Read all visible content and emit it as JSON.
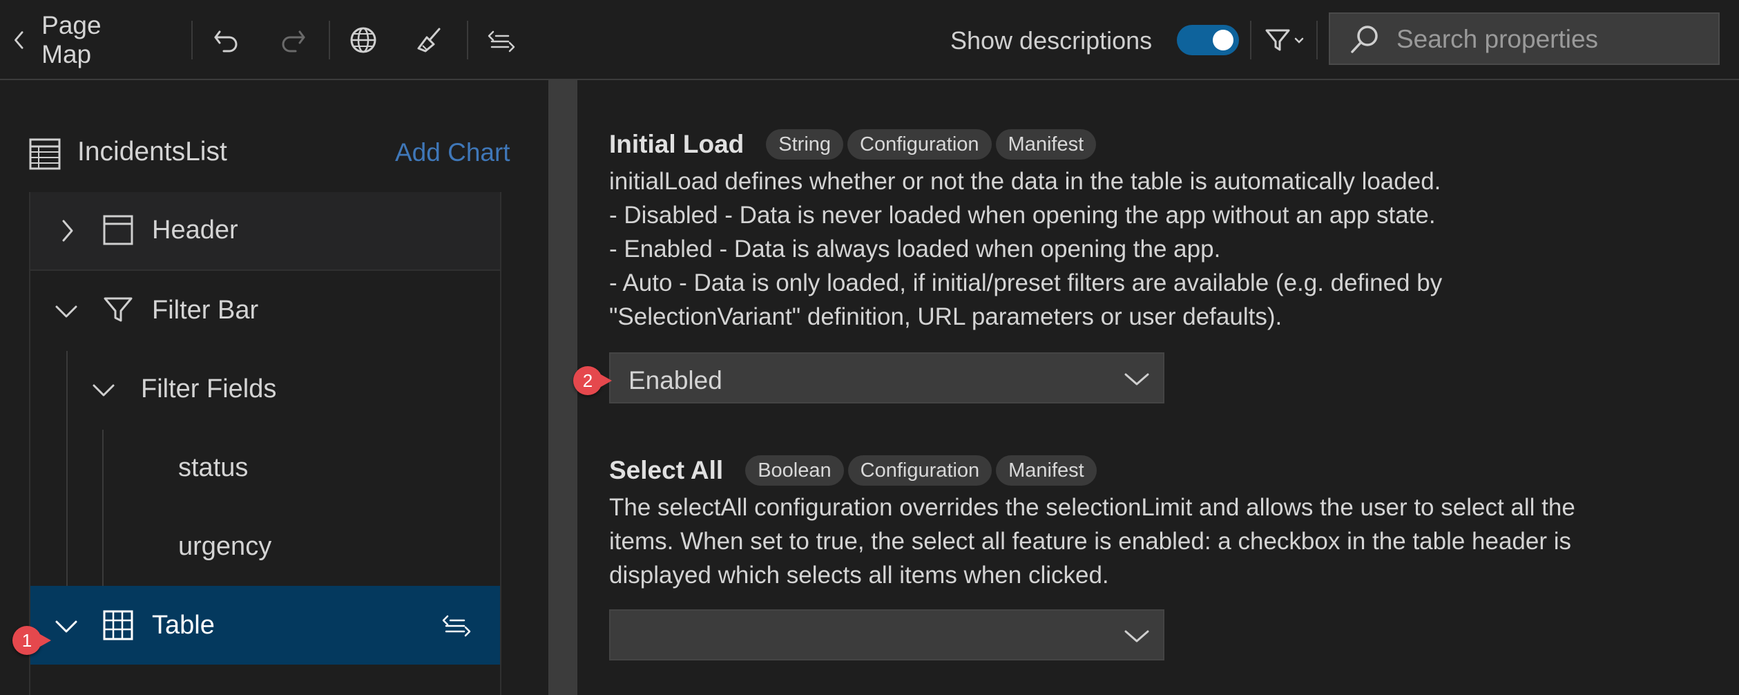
{
  "toolbar": {
    "title": "Page Map",
    "show_descriptions_label": "Show descriptions",
    "show_descriptions_on": true,
    "search_placeholder": "Search properties"
  },
  "outline": {
    "root_label": "IncidentsList",
    "add_chart_label": "Add Chart",
    "nodes": [
      {
        "label": "Header",
        "expanded": false,
        "icon": "header-layout-icon"
      },
      {
        "label": "Filter Bar",
        "expanded": true,
        "icon": "filter-icon"
      },
      {
        "label": "Filter Fields",
        "expanded": true
      },
      {
        "label": "status"
      },
      {
        "label": "urgency"
      },
      {
        "label": "Table",
        "expanded": true,
        "icon": "table-grid-icon",
        "selected": true
      }
    ]
  },
  "properties": {
    "initial_load": {
      "title": "Initial Load",
      "tags": [
        "String",
        "Configuration",
        "Manifest"
      ],
      "description_lines": [
        "initialLoad defines whether or not the data in the table is automatically loaded.",
        "- Disabled - Data is never loaded when opening the app without an app state.",
        "- Enabled - Data is always loaded when opening the app.",
        "- Auto - Data is only loaded, if initial/preset filters are available (e.g. defined by",
        "\"SelectionVariant\" definition, URL parameters or user defaults)."
      ],
      "value": "Enabled"
    },
    "select_all": {
      "title": "Select All",
      "tags": [
        "Boolean",
        "Configuration",
        "Manifest"
      ],
      "description_lines": [
        "The selectAll configuration overrides the selectionLimit and allows the user to select all the",
        "items. When set to true, the select all feature is enabled: a checkbox in the table header is",
        "displayed which selects all items when clicked."
      ],
      "value": ""
    }
  },
  "markers": [
    "1",
    "2"
  ],
  "colors": {
    "background": "#1e1e1e",
    "selected_row": "#04395e",
    "toggle_on": "#0e639c",
    "link": "#3f77b8",
    "marker": "#e5484d"
  }
}
